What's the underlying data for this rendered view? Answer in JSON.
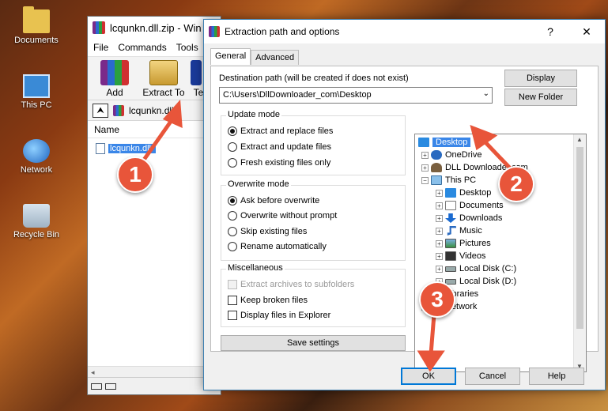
{
  "desktop": {
    "icons": [
      {
        "label": "Documents",
        "icon": "folder-icon"
      },
      {
        "label": "This PC",
        "icon": "computer-icon"
      },
      {
        "label": "Network",
        "icon": "network-icon"
      },
      {
        "label": "Recycle Bin",
        "icon": "recycle-bin-icon"
      }
    ]
  },
  "main_window": {
    "title": "lcqunkn.dll.zip - Win",
    "menu": [
      "File",
      "Commands",
      "Tools"
    ],
    "toolbar": {
      "add": "Add",
      "extract_to": "Extract To",
      "test": "Te"
    },
    "path": "lcqunkn.dll.",
    "column_name": "Name",
    "file": "lcqunkn.dll"
  },
  "dialog": {
    "title": "Extraction path and options",
    "help": "?",
    "close": "✕",
    "tabs": [
      "General",
      "Advanced"
    ],
    "dest_label": "Destination path (will be created if does not exist)",
    "dest_value": "C:\\Users\\DllDownloader_com\\Desktop",
    "display_button": "Display",
    "new_folder_button": "New Folder",
    "update_mode": {
      "title": "Update mode",
      "options": [
        "Extract and replace files",
        "Extract and update files",
        "Fresh existing files only"
      ],
      "selected": 0
    },
    "overwrite_mode": {
      "title": "Overwrite mode",
      "options": [
        "Ask before overwrite",
        "Overwrite without prompt",
        "Skip existing files",
        "Rename automatically"
      ],
      "selected": 0
    },
    "misc": {
      "title": "Miscellaneous",
      "options": [
        "Extract archives to subfolders",
        "Keep broken files",
        "Display files in Explorer"
      ]
    },
    "save_settings": "Save settings",
    "tree": [
      "Desktop",
      "OneDrive",
      "DLL Downloader.com",
      "This PC",
      "Desktop",
      "Documents",
      "Downloads",
      "Music",
      "Pictures",
      "Videos",
      "Local Disk (C:)",
      "Local Disk (D:)",
      "Libraries",
      "Network"
    ],
    "ok": "OK",
    "cancel": "Cancel",
    "help_button": "Help"
  },
  "annotations": {
    "markers": [
      "1",
      "2",
      "3"
    ],
    "color": "#e8553a"
  }
}
